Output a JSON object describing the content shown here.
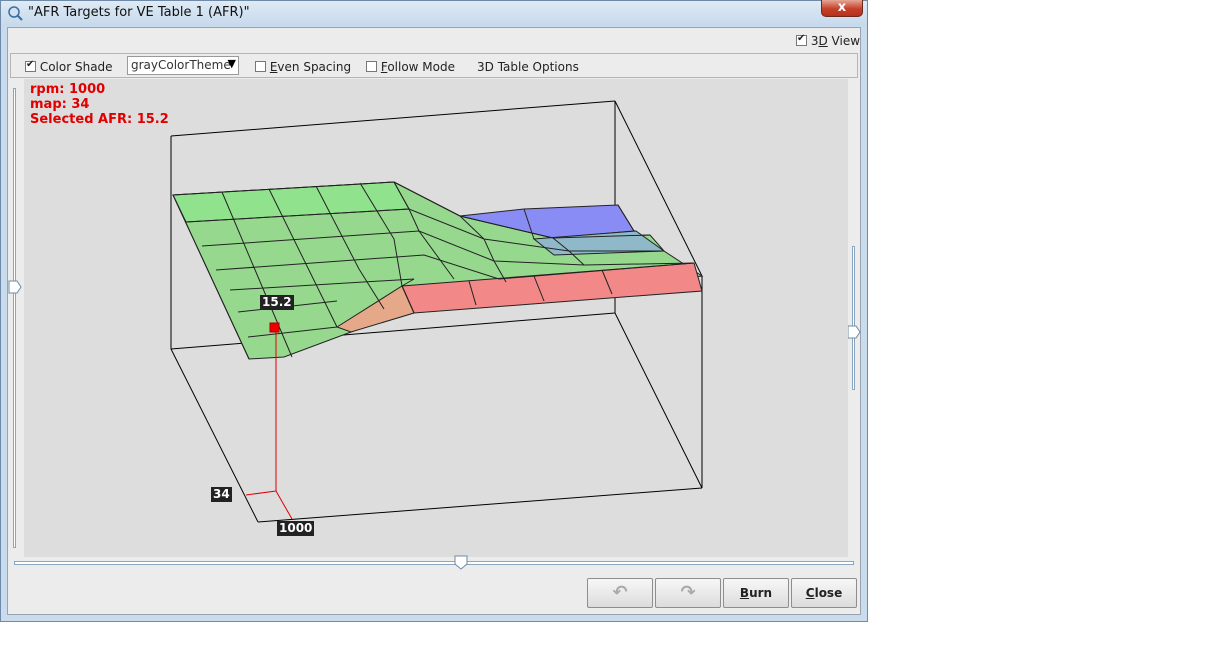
{
  "window": {
    "title": "\"AFR Targets for VE Table 1 (AFR)\"",
    "close_label": "x"
  },
  "view_toggle": {
    "label_prefix": "3",
    "label_mnemonic": "D",
    "label_rest": " View",
    "checked": true
  },
  "toolbar": {
    "color_shade": {
      "label": "Color Shade",
      "checked": true
    },
    "theme_combo": {
      "value": "grayColorTheme",
      "arrow": "▼"
    },
    "even_spacing": {
      "mnemonic": "E",
      "label_rest": "ven Spacing",
      "checked": false
    },
    "follow_mode": {
      "mnemonic": "F",
      "label_rest": "ollow Mode",
      "checked": false
    },
    "table_options": {
      "label": "3D Table Options"
    }
  },
  "readout": {
    "rpm": "rpm: 1000",
    "map": "map: 34",
    "afr": "Selected AFR: 15.2"
  },
  "cursor_labels": {
    "value": "15.2",
    "map": "34",
    "rpm": "1000"
  },
  "buttons": {
    "undo": "↶",
    "redo": "↷",
    "burn_mnemonic": "B",
    "burn_rest": "urn",
    "close_mnemonic": "C",
    "close_rest": "lose"
  },
  "colors": {
    "green": "#8fdf8c",
    "blue": "#8888ff",
    "red": "#f08888",
    "orange": "#e7a98a",
    "cursor": "#ee0000"
  }
}
